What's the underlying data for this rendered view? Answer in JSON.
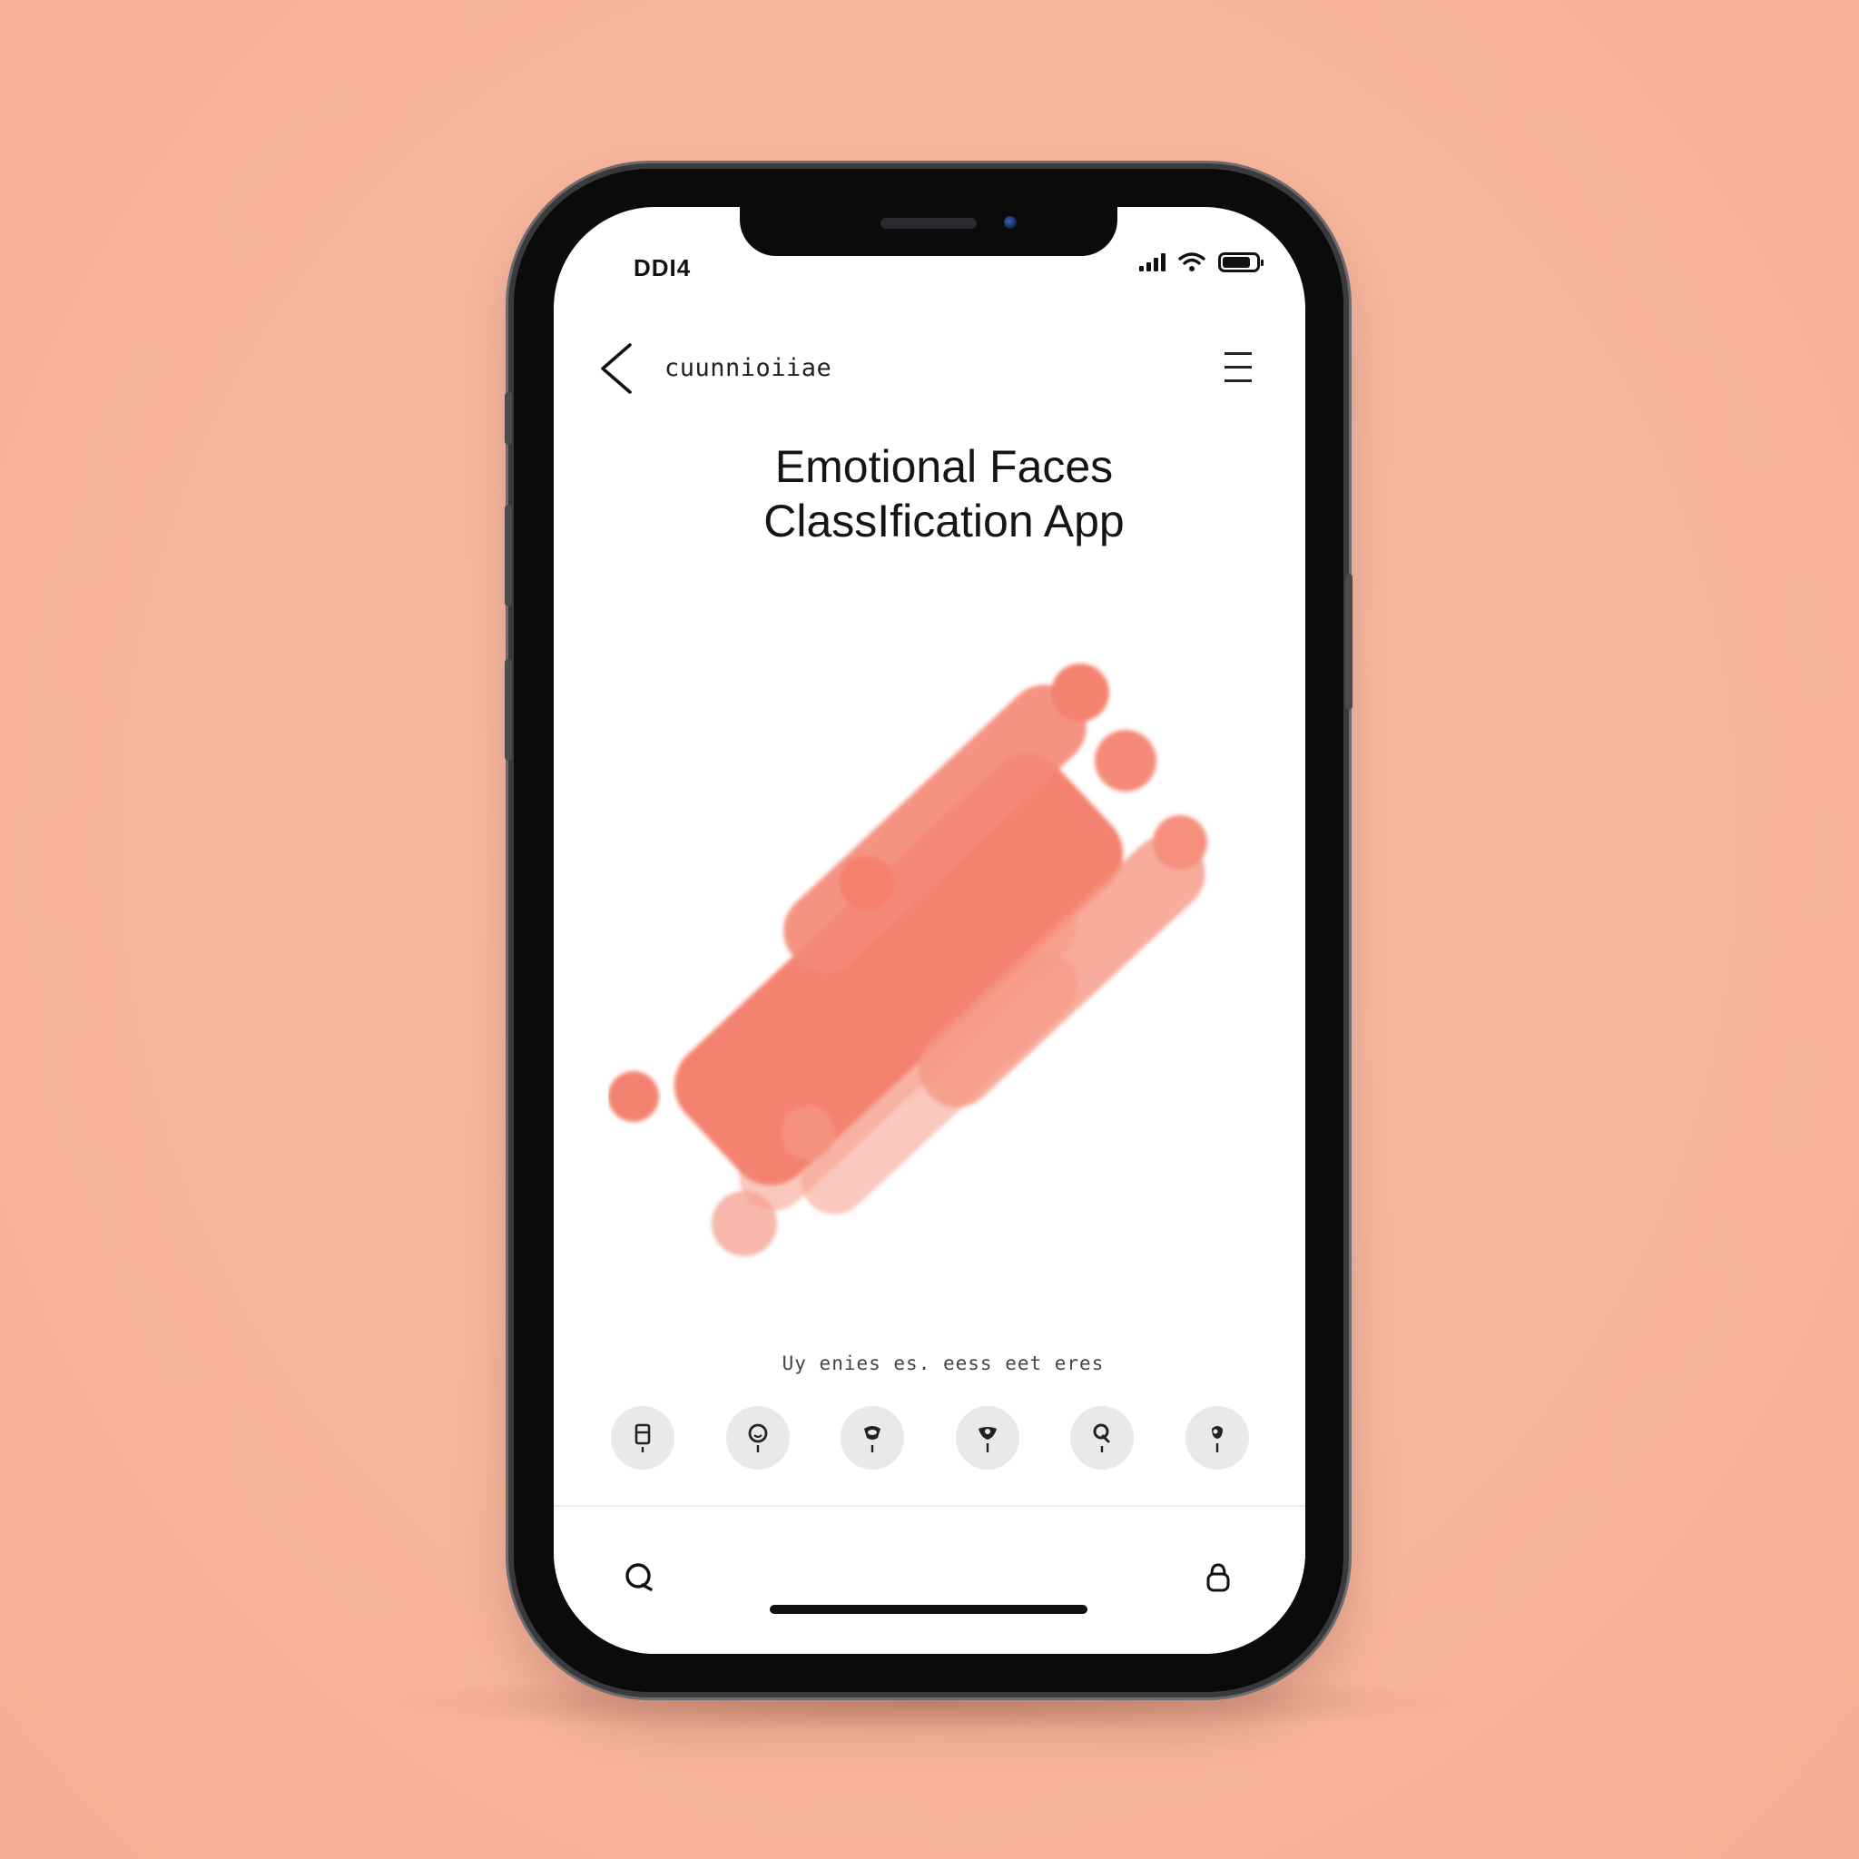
{
  "status_bar": {
    "time": "DDI4"
  },
  "header": {
    "title": "cuunnioiiae"
  },
  "main": {
    "title_line1": "Emotional Faces",
    "title_line2": "ClassIfication App",
    "caption": "Uy enies es. eess eet eres"
  },
  "emotions": [
    {
      "icon": "neutral-face-icon"
    },
    {
      "icon": "happy-face-icon"
    },
    {
      "icon": "sad-face-icon"
    },
    {
      "icon": "surprised-face-icon"
    },
    {
      "icon": "angry-face-icon"
    },
    {
      "icon": "fear-face-icon"
    }
  ],
  "tab_bar": {
    "left_icon": "search-icon",
    "right_icon": "profile-icon"
  },
  "colors": {
    "background": "#f8b8a0",
    "accent": "#f4806e",
    "screen": "#ffffff",
    "frame": "#0b0b0c"
  }
}
